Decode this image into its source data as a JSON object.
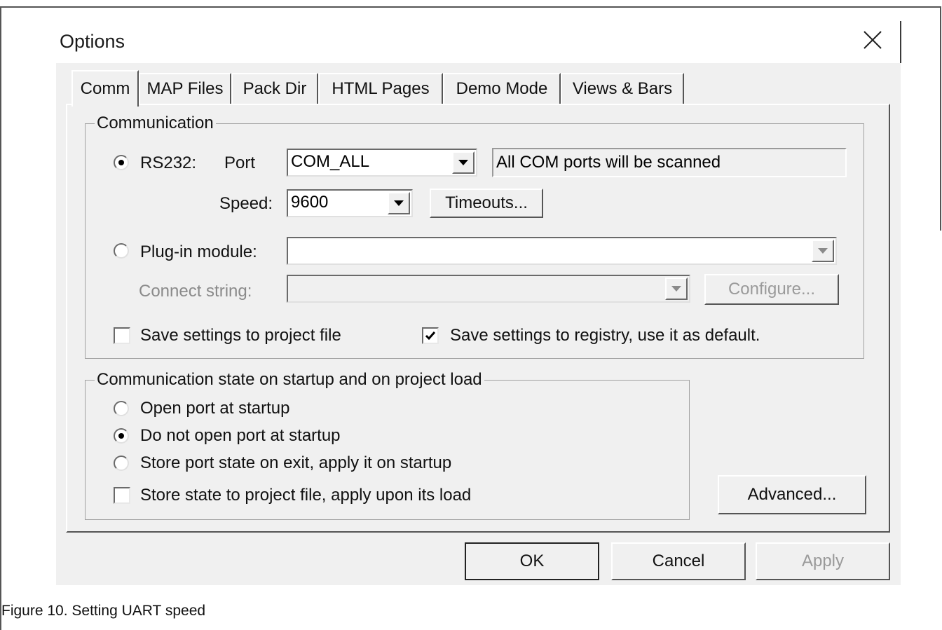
{
  "dialog": {
    "title": "Options",
    "tabs": [
      "Comm",
      "MAP Files",
      "Pack Dir",
      "HTML Pages",
      "Demo Mode",
      "Views & Bars"
    ]
  },
  "communication": {
    "group_label": "Communication",
    "rs232_label": "RS232:",
    "port_label": "Port",
    "port_value": "COM_ALL",
    "port_info": "All COM ports will be scanned",
    "speed_label": "Speed:",
    "speed_value": "9600",
    "timeouts_button": "Timeouts...",
    "plugin_label": "Plug-in module:",
    "plugin_value": "",
    "connect_label": "Connect string:",
    "connect_value": "",
    "configure_button": "Configure...",
    "save_project_label": "Save settings to project file",
    "save_registry_label": "Save settings to registry, use it as default.",
    "rs232_selected": true,
    "save_project_checked": false,
    "save_registry_checked": true
  },
  "startup": {
    "group_label": "Communication state on startup and on project load",
    "open_port": "Open port at startup",
    "do_not_open": "Do not open port at startup",
    "store_state": "Store port state on exit, apply it on startup",
    "store_project": "Store state to project file, apply upon its load",
    "selected": "do_not_open",
    "store_project_checked": false
  },
  "buttons": {
    "advanced": "Advanced...",
    "ok": "OK",
    "cancel": "Cancel",
    "apply": "Apply"
  },
  "caption": "Figure 10.  Setting UART speed"
}
